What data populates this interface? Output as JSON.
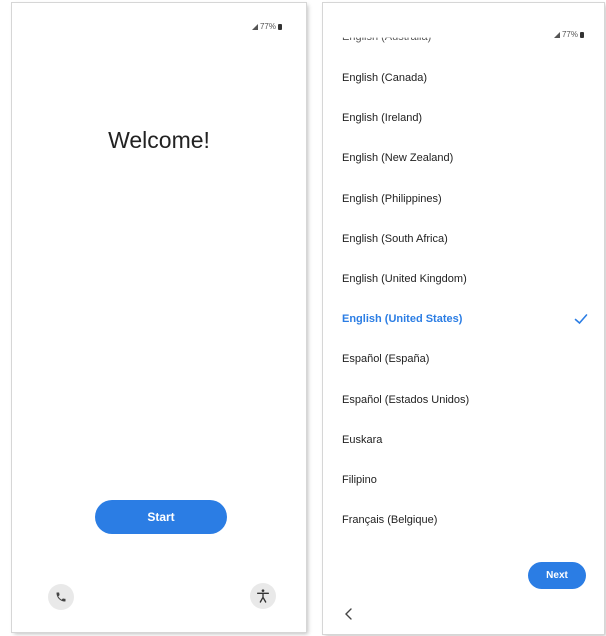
{
  "welcome_screen": {
    "status": {
      "battery": "77%"
    },
    "title": "Welcome!",
    "start_label": "Start",
    "call_icon": "phone-icon",
    "accessibility_icon": "accessibility-icon"
  },
  "language_screen": {
    "status": {
      "battery": "77%"
    },
    "partial_item": "English (Australia)",
    "items": [
      {
        "label": "English (Canada)"
      },
      {
        "label": "English (Ireland)"
      },
      {
        "label": "English (New Zealand)"
      },
      {
        "label": "English (Philippines)"
      },
      {
        "label": "English (South Africa)"
      },
      {
        "label": "English (United Kingdom)"
      },
      {
        "label": "English (United States)",
        "selected": true
      },
      {
        "label": "Español (España)"
      },
      {
        "label": "Español (Estados Unidos)"
      },
      {
        "label": "Euskara"
      },
      {
        "label": "Filipino"
      },
      {
        "label": "Français (Belgique)"
      }
    ],
    "next_label": "Next",
    "back_icon": "chevron-left-icon"
  },
  "colors": {
    "accent": "#2b7de4",
    "icon_bg": "#e9e9e9"
  }
}
